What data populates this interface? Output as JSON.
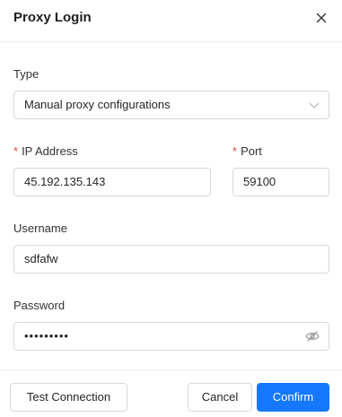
{
  "dialog": {
    "title": "Proxy Login"
  },
  "form": {
    "type": {
      "label": "Type",
      "value": "Manual proxy configurations"
    },
    "ip": {
      "required_mark": "*",
      "label": "IP Address",
      "value": "45.192.135.143"
    },
    "port": {
      "required_mark": "*",
      "label": "Port",
      "value": "59100"
    },
    "username": {
      "label": "Username",
      "value": "sdfafw"
    },
    "password": {
      "label": "Password",
      "masked_value": "•••••••••"
    }
  },
  "footer": {
    "test_label": "Test Connection",
    "cancel_label": "Cancel",
    "confirm_label": "Confirm"
  },
  "colors": {
    "primary": "#1677ff",
    "required": "#e5483f",
    "border": "#d9d9d9"
  },
  "icons": [
    "close-icon",
    "chevron-down-icon",
    "eye-off-icon"
  ]
}
